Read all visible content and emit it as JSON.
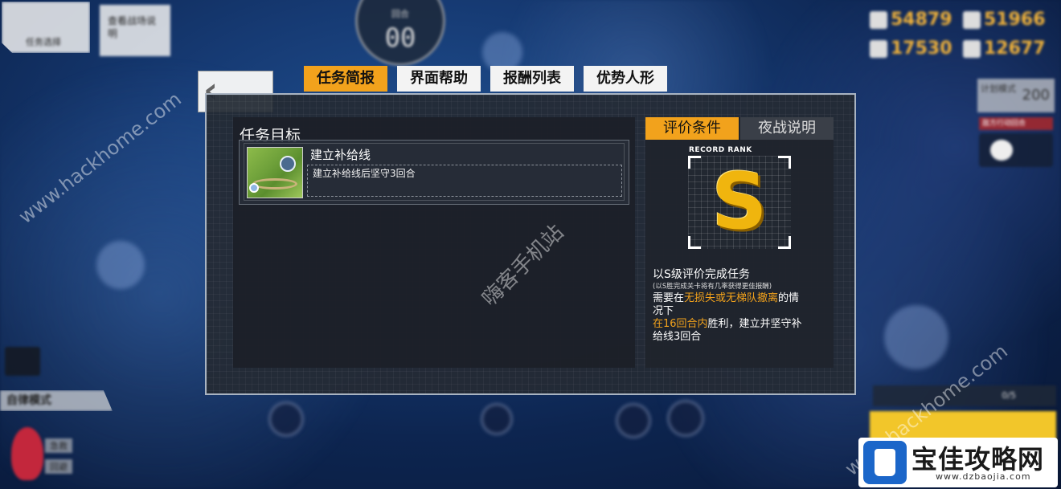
{
  "top_left": {
    "back_label": "任务选择",
    "secondary_label": "查看战场说明"
  },
  "turn_counter": {
    "label": "回合",
    "value": "00"
  },
  "resources": [
    {
      "icon": "manpower-icon",
      "value": "54879"
    },
    {
      "icon": "ammo-icon",
      "value": "51966"
    },
    {
      "icon": "ration-icon",
      "value": "17530"
    },
    {
      "icon": "parts-icon",
      "value": "12677"
    }
  ],
  "right_side": {
    "widget_label": "计划模式",
    "widget_value": "200",
    "red_label": "敌方行动回合"
  },
  "left_side": {
    "mode_label": "自律模式",
    "indicator_rows": [
      "急救",
      "回避"
    ]
  },
  "bottom_right": {
    "status_text": "0/5"
  },
  "dialog": {
    "back_glyph": "‹",
    "tabs": [
      {
        "label": "任务简报",
        "active": true
      },
      {
        "label": "界面帮助",
        "active": false
      },
      {
        "label": "报酬列表",
        "active": false
      },
      {
        "label": "优势人形",
        "active": false
      }
    ],
    "objective": {
      "heading": "任务目标",
      "name": "建立补给线",
      "description": "建立补给线后坚守3回合"
    },
    "right_tabs": [
      {
        "label": "评价条件",
        "active": true
      },
      {
        "label": "夜战说明",
        "active": false
      }
    ],
    "rank": {
      "label": "RECORD RANK",
      "letter": "S"
    },
    "evaluation": {
      "title": "以S级评价完成任务",
      "note": "(以S胜完成关卡将有几率获得更佳报酬)",
      "line1_prefix": "需要在",
      "line1_highlight": "无损失或无梯队撤离",
      "line1_suffix": "的情",
      "line2": "况下",
      "line3_highlight": "在16回合内",
      "line3_suffix": "胜利，建立并坚守补",
      "line4": "给线3回合"
    }
  },
  "watermarks": {
    "site_text": "www.hackhome.com",
    "center_text": "嗨客手机站"
  },
  "brand": {
    "name": "宝佳攻略网",
    "url": "www.dzbaojia.com"
  },
  "colors": {
    "accent": "#f2a21c",
    "panel_bg": "#242a34",
    "rank_gold": "#f0b50e",
    "brand_blue": "#1b66c9"
  }
}
